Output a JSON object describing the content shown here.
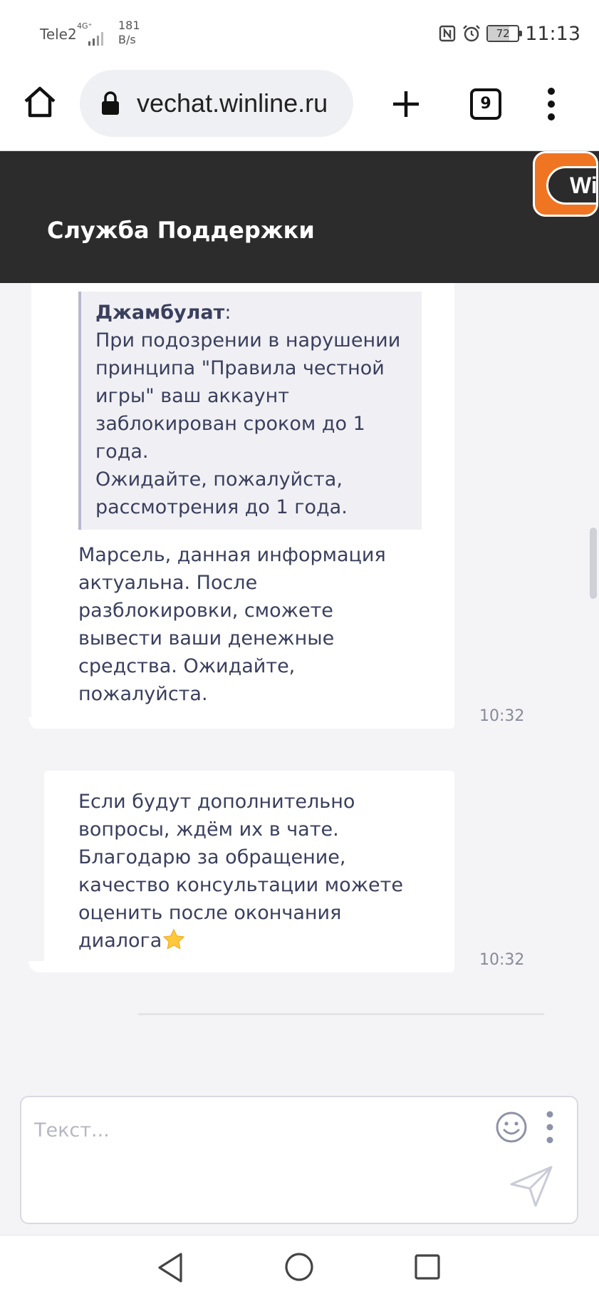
{
  "status_bar": {
    "carrier": "Tele2",
    "network_type": "4G⁺",
    "speed_value": "181",
    "speed_unit": "B/s",
    "battery_level": "72",
    "battery_fraction": 0.72,
    "time": "11:13",
    "icons": [
      "nfc-icon",
      "alarm-icon",
      "battery-icon"
    ]
  },
  "browser": {
    "url": "vechat.winline.ru",
    "tab_count": "9"
  },
  "header": {
    "title": "Служба Поддержки",
    "logo_text": "Win"
  },
  "messages": [
    {
      "quote_author": "Джамбулат",
      "quote_colon": ":",
      "quote_text": "При подозрении в нарушении\nпринципа \"Правила честной\nигры\" ваш аккаунт\nзаблокирован сроком до 1\nгода.\nОжидайте, пожалуйста,\nрассмотрения до 1 года.",
      "text": "Марсель, данная информация\nактуальна. После\nразблокировки, сможете\nвывести ваши денежные\nсредства. Ожидайте,\nпожалуйста.",
      "time": "10:32"
    },
    {
      "text": "Если будут дополнительно\nвопросы, ждём их в чате.\nБлагодарю за обращение,\nкачество консультации можете\nоценить после окончания\nдиалога",
      "emoji": "star",
      "time": "10:32"
    }
  ],
  "composer": {
    "placeholder": "Текст..."
  },
  "colors": {
    "header_bg": "#2c2c2c",
    "brand_orange": "#f07522",
    "text": "#3a3f5e",
    "page_bg": "#f4f4f6"
  }
}
